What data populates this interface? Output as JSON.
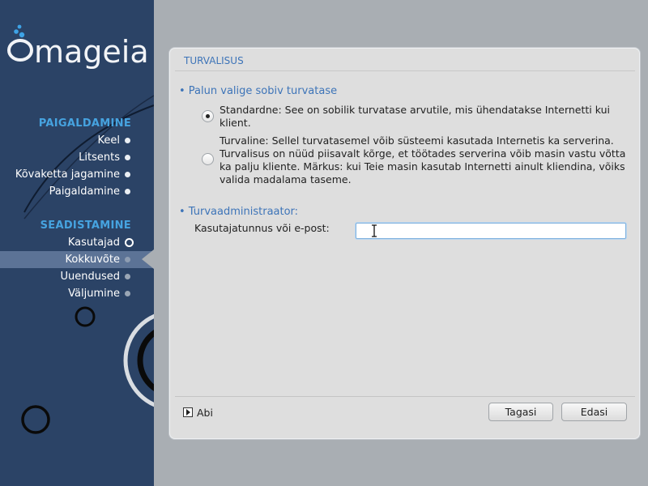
{
  "brand": {
    "logo_text": "mageia"
  },
  "sidebar": {
    "sections": [
      {
        "title": "PAIGALDAMINE",
        "items": [
          {
            "label": "Keel",
            "state": "done"
          },
          {
            "label": "Litsents",
            "state": "done"
          },
          {
            "label": "Kõvaketta jagamine",
            "state": "done"
          },
          {
            "label": "Paigaldamine",
            "state": "done"
          }
        ]
      },
      {
        "title": "SEADISTAMINE",
        "items": [
          {
            "label": "Kasutajad",
            "state": "current"
          },
          {
            "label": "Kokkuvõte",
            "state": "active"
          },
          {
            "label": "Uuendused",
            "state": "pending"
          },
          {
            "label": "Väljumine",
            "state": "pending"
          }
        ]
      }
    ]
  },
  "main": {
    "title": "TURVALISUS",
    "security_group": {
      "title": "• Palun valige sobiv turvatase",
      "options": [
        {
          "label": "Standardne: See on sobilik turvatase arvutile, mis ühendatakse Internetti kui klient.",
          "checked": true
        },
        {
          "label": "Turvaline: Sellel turvatasemel võib süsteemi kasutada Internetis ka serverina. Turvalisus on nüüd piisavalt kõrge, et töötades serverina võib masin vastu võtta ka palju kliente. Märkus: kui Teie masin kasutab Internetti ainult kliendina, võiks valida madalama taseme.",
          "checked": false
        }
      ]
    },
    "admin_group": {
      "title": "• Turvaadministraator:",
      "field_label": "Kasutajatunnus või e-post:",
      "field_value": ""
    },
    "footer": {
      "help_label": "Abi",
      "back_label": "Tagasi",
      "next_label": "Edasi"
    }
  },
  "colors": {
    "sidebar_bg": "#2b4366",
    "section_title": "#46a3e0",
    "group_title": "#3d74b8",
    "window_bg": "#a9aeb3"
  }
}
